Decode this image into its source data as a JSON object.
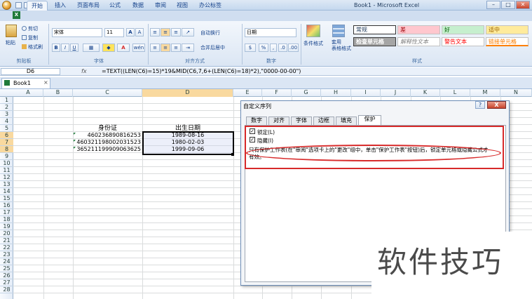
{
  "window": {
    "title": "Book1 - Microsoft Excel",
    "minimize": "–",
    "maximize": "□",
    "close": "✕"
  },
  "tabs": [
    "开始",
    "插入",
    "页面布局",
    "公式",
    "数据",
    "审阅",
    "视图",
    "办公标签"
  ],
  "ribbon": {
    "clipboard": {
      "paste": "粘贴",
      "cut": "剪切",
      "copy": "复制",
      "format_painter": "格式刷",
      "label": "剪贴板"
    },
    "font": {
      "name": "宋体",
      "size": "11",
      "bold": "B",
      "italic": "I",
      "underline": "U",
      "grow": "A",
      "shrink": "A",
      "font_color": "A",
      "phonetic": "wén",
      "label": "字体"
    },
    "alignment": {
      "wrap": "自动换行",
      "merge": "合并后居中",
      "label": "对齐方式"
    },
    "number": {
      "format": "日期",
      "currency": "$",
      "percent": "%",
      "comma": ",",
      "inc_decimal": ".0",
      "dec_decimal": ".00",
      "label": "数字"
    },
    "styles": {
      "conditional": "条件格式",
      "table_format": "套用\n表格格式",
      "cells": [
        "常规",
        "差",
        "好",
        "适中",
        "检查单元格",
        "解释性文本",
        "警告文本",
        "链接单元格"
      ],
      "label": "样式"
    }
  },
  "formula_bar": {
    "name_box": "D6",
    "fx": "fx",
    "formula": "=TEXT((LEN(C6)=15)*19&MID(C6,7,6+(LEN(C6)=18)*2),\"0000-00-00\")"
  },
  "workbook_tab": {
    "name": "Book1",
    "close": "×"
  },
  "columns": [
    "A",
    "B",
    "C",
    "D",
    "E",
    "F",
    "G",
    "H",
    "I",
    "J",
    "K",
    "L",
    "M",
    "N"
  ],
  "rows": [
    "1",
    "2",
    "3",
    "4",
    "5",
    "6",
    "7",
    "8",
    "9",
    "10",
    "11",
    "12",
    "13",
    "14",
    "15",
    "16",
    "17",
    "18",
    "19",
    "20",
    "21",
    "22",
    "23",
    "24",
    "25",
    "26",
    "27",
    "28"
  ],
  "cells": {
    "c5": "身份证",
    "d5": "出生日期",
    "c6": "460236890816253",
    "d6": "1989-08-16",
    "c7": "460321198002031523",
    "d7": "1980-02-03",
    "c8": "365211199909063625",
    "d8": "1999-09-06"
  },
  "dialog": {
    "title": "自定义序列",
    "help": "?",
    "close": "X",
    "tabs": [
      "数字",
      "对齐",
      "字体",
      "边框",
      "填充",
      "保护"
    ],
    "locked_label": "锁定(L)",
    "hidden_label": "隐藏(I)",
    "note": "只有保护工作表(在\"审阅\"选项卡上的\"更改\"组中，单击\"保护工作表\"按钮)后，锁定单元格或隐藏公式才",
    "note2": "有效。"
  },
  "watermark": "软件技巧",
  "colors": {
    "selected_header": "#f9d99f",
    "highlight": "#d72a2a",
    "ribbon_bg": "#dbe6f4"
  }
}
